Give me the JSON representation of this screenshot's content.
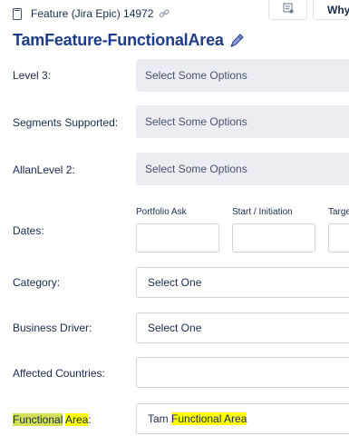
{
  "header": {
    "feature_label": "Feature (Jira Epic) 14972",
    "why_button": "Why",
    "title": "TamFeature-FunctionalArea",
    "icons": [
      "document-icon",
      "link-icon",
      "filter-icon",
      "edit-icon"
    ]
  },
  "fields": {
    "level3": {
      "label": "Level 3:",
      "placeholder": "Select Some Options"
    },
    "segments": {
      "label": "Segments Supported:",
      "placeholder": "Select Some Options"
    },
    "allan_level2": {
      "label": "AllanLevel 2:",
      "placeholder": "Select Some Options"
    },
    "dates": {
      "label": "Dates:",
      "columns": [
        "Portfolio Ask",
        "Start / Initiation",
        "Targe"
      ]
    },
    "category": {
      "label": "Category:",
      "value": "Select One"
    },
    "business_driver": {
      "label": "Business Driver:",
      "value": "Select One"
    },
    "affected_countries": {
      "label": "Affected Countries:",
      "value": ""
    },
    "functional_area": {
      "label_part1": "Functional",
      "label_part2": "Area",
      "label_suffix": ":",
      "value_prefix": "Tam ",
      "value_highlight": "Functional Area"
    }
  },
  "colors": {
    "title": "#1f3c88",
    "highlight": "#ffff00",
    "label_highlight": "#d4e157",
    "multi_bg": "#ebedf2"
  }
}
